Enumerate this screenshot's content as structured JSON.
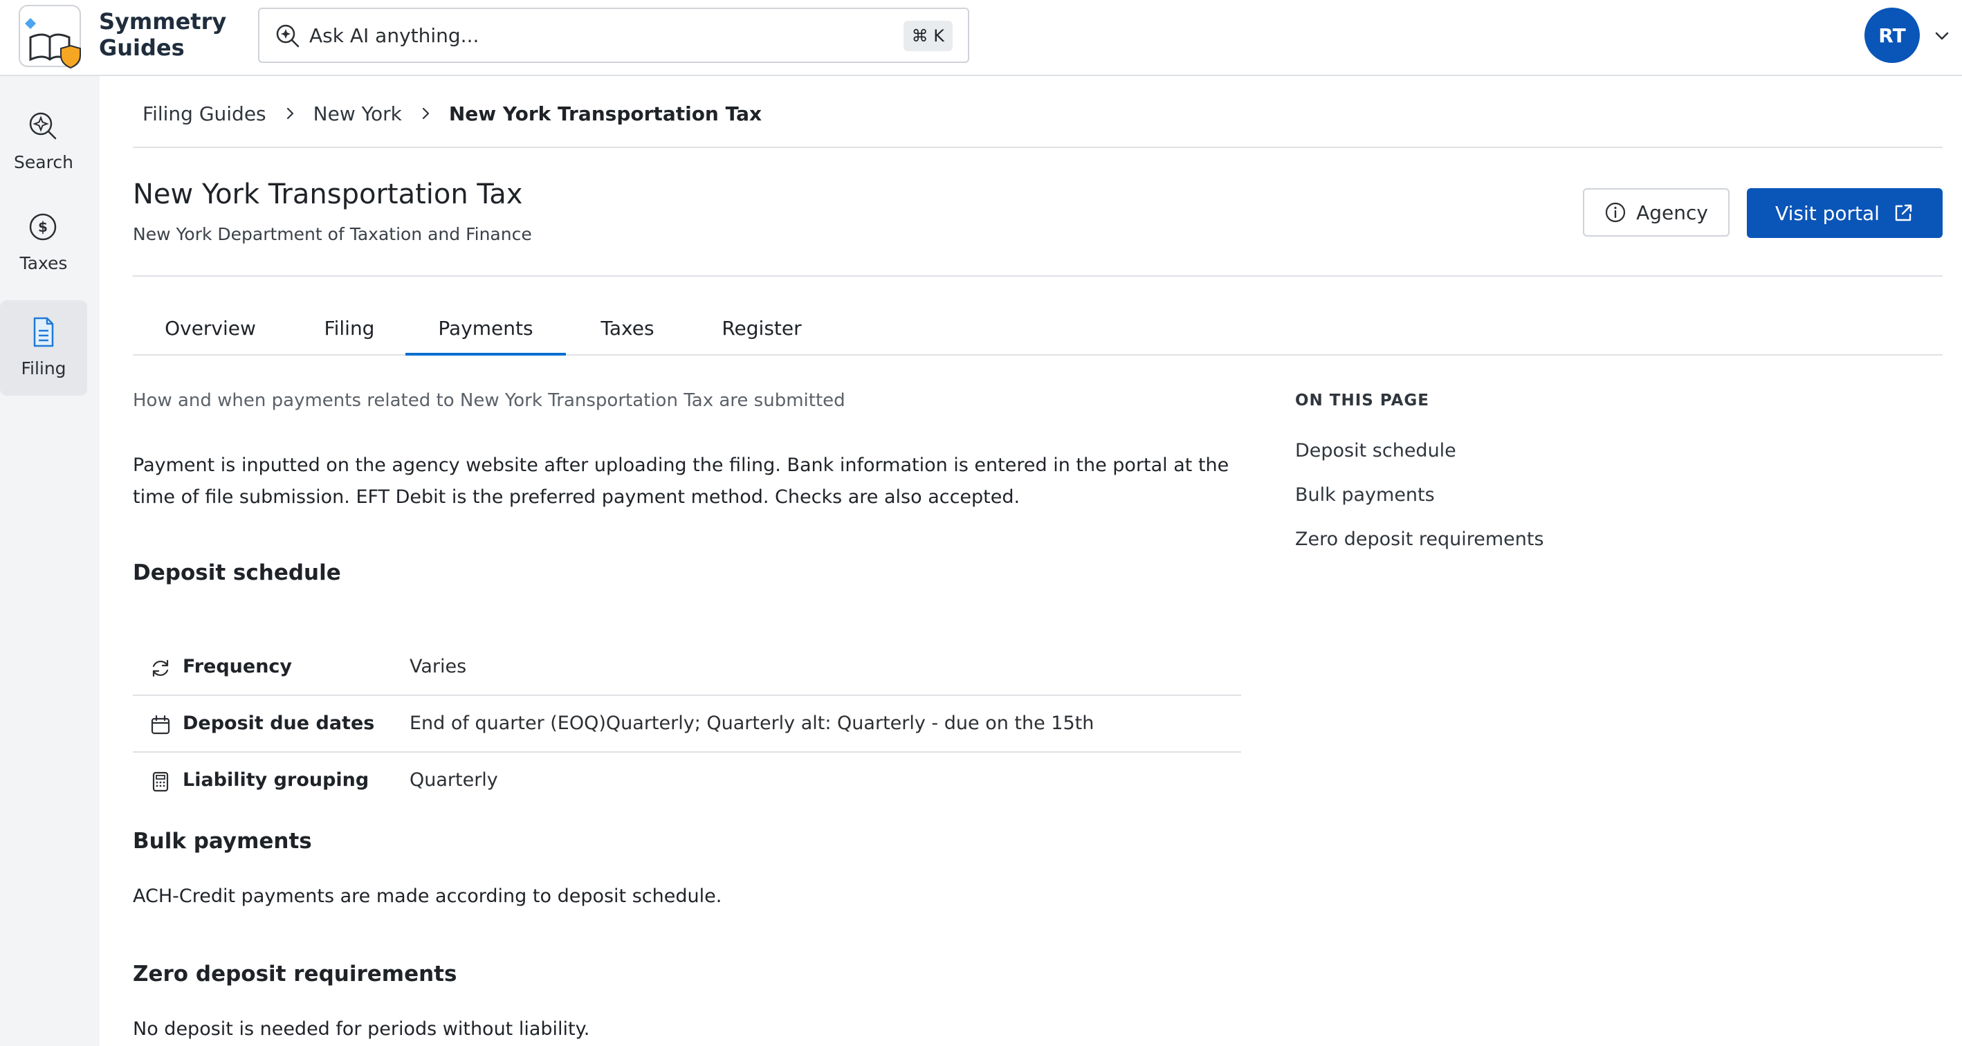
{
  "app": {
    "brand_line1": "Symmetry",
    "brand_line2": "Guides"
  },
  "search": {
    "placeholder": "Ask AI anything...",
    "shortcut": "⌘ K"
  },
  "user": {
    "initials": "RT"
  },
  "sidebar": {
    "items": [
      {
        "label": "Search",
        "icon": "sparkle-search-icon",
        "active": false
      },
      {
        "label": "Taxes",
        "icon": "dollar-circle-icon",
        "active": false
      },
      {
        "label": "Filing",
        "icon": "document-icon",
        "active": true
      }
    ]
  },
  "breadcrumb": {
    "items": [
      "Filing Guides",
      "New York",
      "New York Transportation Tax"
    ]
  },
  "page": {
    "title": "New York Transportation Tax",
    "subtitle": "New York Department of Taxation and Finance",
    "agency_button": "Agency",
    "portal_button": "Visit portal"
  },
  "tabs": [
    {
      "label": "Overview",
      "active": false
    },
    {
      "label": "Filing",
      "active": false
    },
    {
      "label": "Payments",
      "active": true
    },
    {
      "label": "Taxes",
      "active": false
    },
    {
      "label": "Register",
      "active": false
    }
  ],
  "main": {
    "intro": "How and when payments related to New York Transportation Tax are submitted",
    "paragraph": "Payment is inputted on the agency website after uploading the filing. Bank information is entered in the portal at the time of file submission. EFT Debit is the preferred payment method. Checks are also accepted.",
    "deposit_schedule": {
      "heading": "Deposit schedule",
      "rows": [
        {
          "label": "Frequency",
          "value": "Varies",
          "icon": "refresh-icon"
        },
        {
          "label": "Deposit due dates",
          "value": "End of quarter (EOQ)Quarterly; Quarterly alt: Quarterly - due on the 15th",
          "icon": "calendar-icon"
        },
        {
          "label": "Liability grouping",
          "value": "Quarterly",
          "icon": "calculator-icon"
        }
      ]
    },
    "bulk_payments": {
      "heading": "Bulk payments",
      "text": "ACH-Credit payments are made according to deposit schedule."
    },
    "zero_deposit": {
      "heading": "Zero deposit requirements",
      "text": "No deposit is needed for periods without liability."
    }
  },
  "toc": {
    "title": "ON THIS PAGE",
    "items": [
      "Deposit schedule",
      "Bulk payments",
      "Zero deposit requirements"
    ]
  },
  "colors": {
    "primary": "#0a55b8",
    "tab_underline": "#0a6fd1",
    "sidebar_bg": "#f3f4f6",
    "border": "#dfe1e5"
  }
}
